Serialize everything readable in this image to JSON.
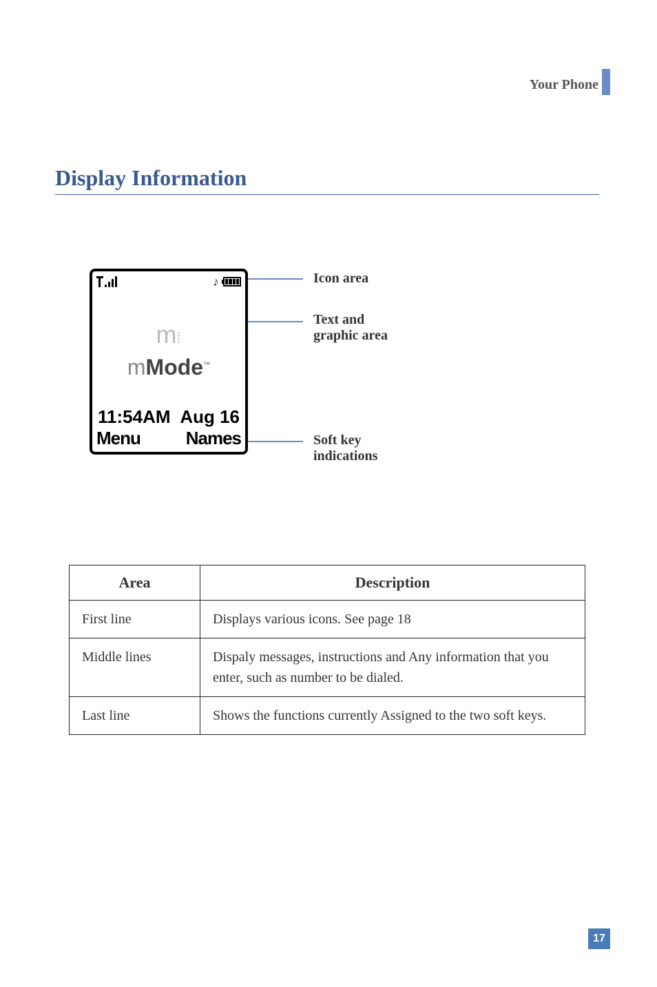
{
  "header": {
    "label": "Your Phone"
  },
  "section": {
    "title": "Display Information"
  },
  "callouts": {
    "icon_area": "Icon area",
    "text_graphic": "Text and\ngraphic area",
    "softkey": "Soft key\nindications"
  },
  "screen": {
    "brand_m": "m",
    "brand_dots": "⁞",
    "mmode_m": "m",
    "mmode_mode": "Mode",
    "mmode_tm": "™",
    "time": "11:54AM",
    "date": "Aug 16",
    "softkey_left": "Menu",
    "softkey_right": "Names"
  },
  "table": {
    "headers": {
      "area": "Area",
      "description": "Description"
    },
    "rows": [
      {
        "area": "First line",
        "desc": "Displays various icons. See page 18"
      },
      {
        "area": "Middle lines",
        "desc": "Dispaly messages, instructions and Any information that you enter, such as number to be dialed."
      },
      {
        "area": "Last line",
        "desc": "Shows the functions currently Assigned to the two soft keys."
      }
    ]
  },
  "page": {
    "number": "17"
  }
}
